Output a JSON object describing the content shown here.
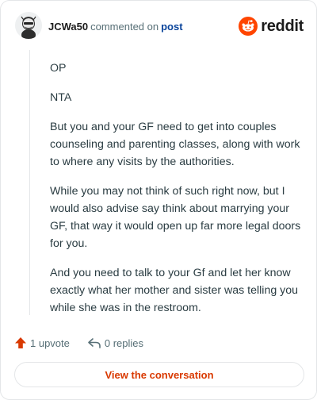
{
  "header": {
    "username": "JCWa50",
    "action_text": "commented on",
    "link_text": "post",
    "brand": "reddit"
  },
  "comment": {
    "paragraphs": [
      "OP",
      "NTA",
      "But you and your GF need to get into couples counseling and parenting classes, along with work to where any visits by the authorities.",
      "While you may not think of such right now, but I would also advise say think about marrying your GF, that way it would open up far more legal doors for you.",
      "And you need to talk to your Gf and let her know exactly what her mother and sister was telling you while she was in the restroom."
    ]
  },
  "actions": {
    "upvote_label": "1 upvote",
    "replies_label": "0 replies"
  },
  "footer": {
    "view_button": "View the conversation"
  },
  "colors": {
    "brand_orange": "#ff4500",
    "upvote": "#d93900",
    "link": "#0a449b"
  }
}
